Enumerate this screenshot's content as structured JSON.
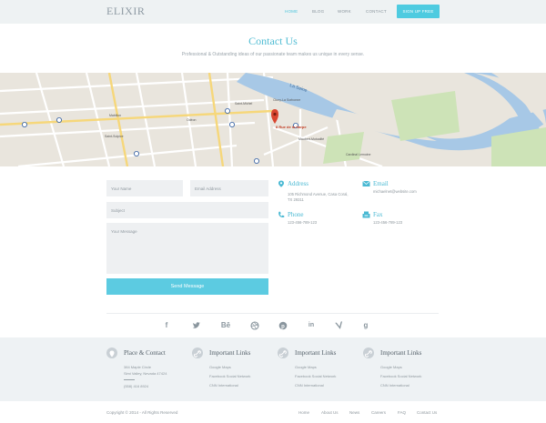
{
  "header": {
    "logo": "ELIXIR",
    "nav": [
      "HOME",
      "BLOG",
      "WORK",
      "CONTACT"
    ],
    "signup": "SIGN UP FREE"
  },
  "page": {
    "title": "Contact Us",
    "subtitle": "Professional & Outstanding ideas  of our passionate team makes us unique in every sense."
  },
  "map": {
    "pin_label": "8 Rue de la Harpe",
    "river_label": "La Seine",
    "place_labels": [
      "Saint-Michel",
      "Odéon",
      "Mabillon",
      "Saint-Sulpice",
      "Maubert-Mutualité",
      "Cluny-La Sorbonne",
      "Cardinal Lemoine"
    ]
  },
  "form": {
    "name_placeholder": "Your Name",
    "email_placeholder": "Email Address",
    "subject_placeholder": "Subject",
    "message_placeholder": "Your Message",
    "send_label": "Send Message"
  },
  "contact_info": {
    "address_title": "Address",
    "address_lines": [
      "105 Richmond Avenue, Casa Coral,",
      "TX 29311"
    ],
    "email_title": "Email",
    "email_value": "michaelnet@website.com",
    "phone_title": "Phone",
    "phone_value": "123-456-789-123",
    "fax_title": "Fax",
    "fax_value": "123-456-789-123"
  },
  "social_icons": [
    "facebook-icon",
    "twitter-icon",
    "behance-icon",
    "dribbble-icon",
    "pinterest-icon",
    "linkedin-icon",
    "vine-icon",
    "google-plus-icon"
  ],
  "footer": {
    "place": {
      "title": "Place & Contact",
      "lines": [
        "384 Maple Circle",
        "Simi Valley, Nevada 47424"
      ],
      "phone": "(558) 416 8924"
    },
    "links_columns": [
      {
        "title": "Important Links",
        "links": [
          "Google Maps",
          "Facebook Social Network",
          "CNN International"
        ]
      },
      {
        "title": "Important Links",
        "links": [
          "Google Maps",
          "Facebook Social Network",
          "CNN International"
        ]
      },
      {
        "title": "Important Links",
        "links": [
          "Google Maps",
          "Facebook Social Network",
          "CNN International"
        ]
      }
    ]
  },
  "bottom_bar": {
    "copyright": "Copyright © 2014 - All Rights Reserved",
    "links": [
      "Home",
      "About Us",
      "News",
      "Careers",
      "FAQ",
      "Contact Us"
    ]
  },
  "colors": {
    "accent": "#4ecbe0",
    "footer_bg": "#eef2f4",
    "header_bg": "#eef2f3",
    "river": "#9fc4e3"
  }
}
